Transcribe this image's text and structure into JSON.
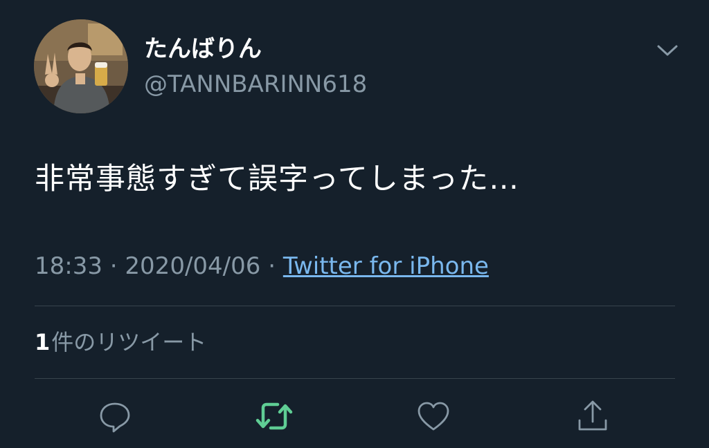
{
  "user": {
    "display_name": "たんばりん",
    "handle": "@TANNBARINN618",
    "avatar_icon": "user-avatar-photo"
  },
  "header": {
    "menu_icon": "chevron-down-icon"
  },
  "tweet": {
    "text": "非常事態すぎて誤字ってしまった…"
  },
  "meta": {
    "time": "18:33",
    "separator_1": " · ",
    "date": "2020/04/06",
    "separator_2": " · ",
    "source": "Twitter for iPhone"
  },
  "stats": {
    "retweet_count": "1",
    "retweet_label": "件のリツイート"
  },
  "actions": {
    "reply_icon": "reply-icon",
    "retweet_icon": "retweet-icon",
    "like_icon": "heart-icon",
    "share_icon": "share-icon"
  },
  "colors": {
    "background": "#15202b",
    "primary_text": "#ffffff",
    "secondary_text": "#8899a6",
    "link": "#7ab8ee",
    "retweet_active": "#5fcd94",
    "divider": "#38444d"
  }
}
